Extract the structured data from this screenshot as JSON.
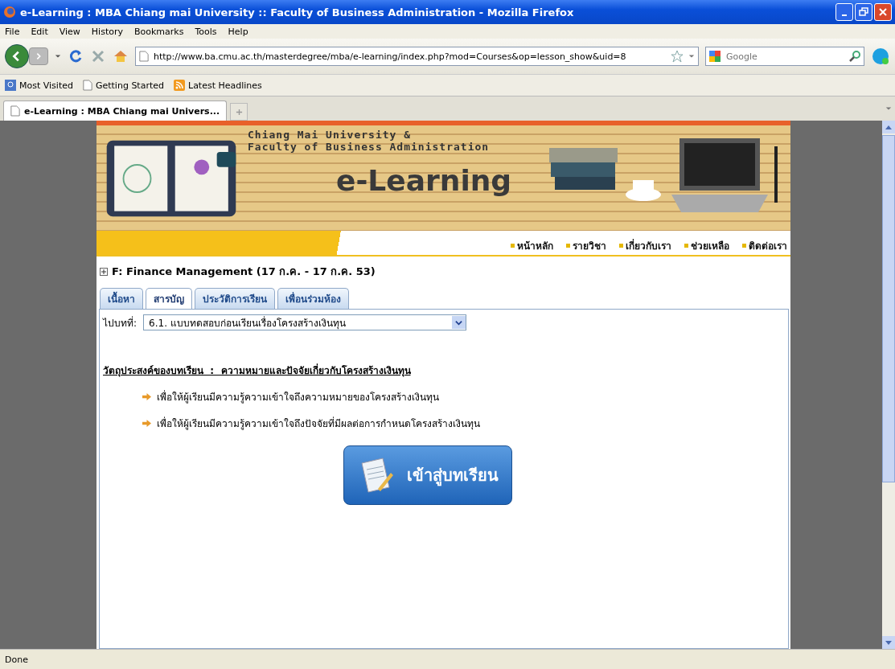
{
  "window": {
    "title": "e-Learning : MBA Chiang mai University :: Faculty of Business Administration - Mozilla Firefox"
  },
  "menu_bar": [
    "File",
    "Edit",
    "View",
    "History",
    "Bookmarks",
    "Tools",
    "Help"
  ],
  "toolbar": {
    "url": "http://www.ba.cmu.ac.th/masterdegree/mba/e-learning/index.php?mod=Courses&op=lesson_show&uid=8",
    "search_placeholder": "Google"
  },
  "bookmarks": [
    {
      "label": "Most Visited",
      "kind": "search"
    },
    {
      "label": "Getting Started",
      "kind": "page"
    },
    {
      "label": "Latest Headlines",
      "kind": "feed"
    }
  ],
  "browser_tabs": [
    {
      "label": "e-Learning : MBA Chiang mai Univers...",
      "selected": true
    }
  ],
  "banner": {
    "line_1": "Chiang Mai University &",
    "line_2": "Faculty of Business Administration",
    "logo": "e-Learning"
  },
  "nav_links": [
    "หน้าหลัก",
    "รายวิชา",
    "เกี่ยวกับเรา",
    "ช่วยเหลือ",
    "ติดต่อเรา"
  ],
  "course_title": "F: Finance Management (17 ก.ค. - 17 ก.ค. 53)",
  "page_tabs": [
    {
      "label": "เนื้อหา",
      "selected": false
    },
    {
      "label": "สารบัญ",
      "selected": true
    },
    {
      "label": "ประวัติการเรียน",
      "selected": false
    },
    {
      "label": "เพื่อนร่วมห้อง",
      "selected": false
    }
  ],
  "jump": {
    "label": "ไปบทที่:",
    "value": "6.1. แบบทดสอบก่อนเรียนเรื่องโครงสร้างเงินทุน"
  },
  "objective_heading": "วัตถุประสงค์ของบทเรียน  :  ความหมายและปัจจัยเกี่ยวกับโครงสร้างเงินทุน",
  "objectives": [
    "เพื่อให้ผู้เรียนมีความรู้ความเข้าใจถึงความหมายของโครงสร้างเงินทุน",
    "เพื่อให้ผู้เรียนมีความรู้ความเข้าใจถึงปัจจัยที่มีผลต่อการกำหนดโครงสร้างเงินทุน"
  ],
  "enter_button": "เข้าสู่บทเรียน",
  "status_bar": "Done"
}
